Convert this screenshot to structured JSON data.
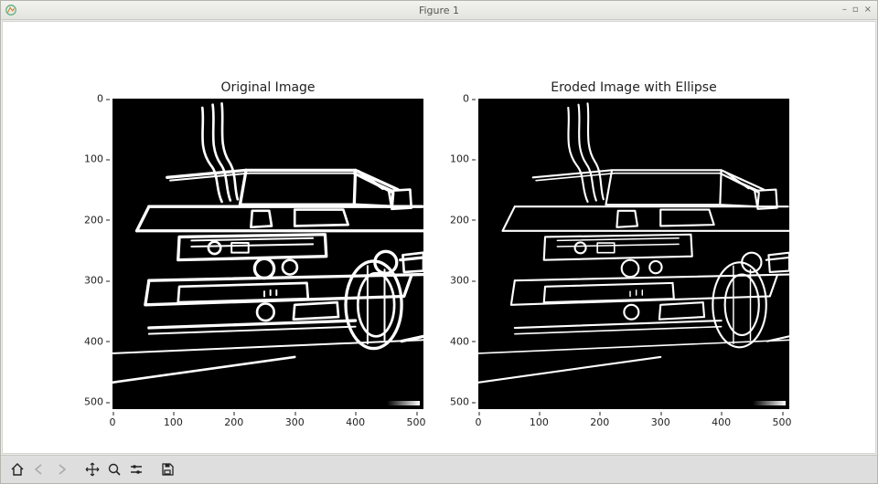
{
  "window": {
    "title": "Figure 1"
  },
  "plots": {
    "left": {
      "title": "Original Image"
    },
    "right": {
      "title": "Eroded Image with Ellipse"
    },
    "xticks": [
      "0",
      "100",
      "200",
      "300",
      "400",
      "500"
    ],
    "yticks": [
      "0",
      "100",
      "200",
      "300",
      "400",
      "500"
    ],
    "xmin": 0,
    "xmax": 512,
    "ymin": 0,
    "ymax": 512
  },
  "toolbar": {
    "home": "Home",
    "back": "Back",
    "forward": "Forward",
    "pan": "Pan",
    "zoom": "Zoom",
    "configure": "Configure subplots",
    "save": "Save"
  },
  "win_controls": {
    "minimize": "–",
    "maximize": "▫",
    "close": "×"
  }
}
